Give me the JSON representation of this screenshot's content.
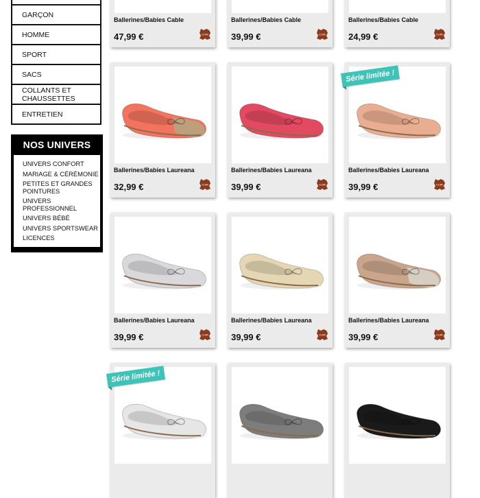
{
  "sidebar": {
    "menu": [
      "GARÇON",
      "HOMME",
      "SPORT",
      "SACS",
      "COLLANTS ET CHAUSSETTES",
      "ENTRETIEN"
    ],
    "univers_title": "NOS UNIVERS",
    "univers_links": [
      "UNIVERS CONFORT",
      "MARIAGE & CÉRÉMONIE",
      "PETITES ET GRANDES POINTURES",
      "UNIVERS PROFESSIONNEL",
      "UNIVERS BÉBÉ",
      "UNIVERS SPORTSWEAR",
      "LICENCES"
    ]
  },
  "leather_icon_label": "CUIR",
  "badge_label": "Série limitée !",
  "products": [
    {
      "title": "Ballerines/Babies Cable",
      "price": "47,99 €",
      "color": "#333333",
      "badge": false
    },
    {
      "title": "Ballerines/Babies Cable",
      "price": "39,99 €",
      "color": "#c9bfb5",
      "badge": false
    },
    {
      "title": "Ballerines/Babies Cable",
      "price": "24,99 €",
      "color": "#ffffff",
      "badge": false
    },
    {
      "title": "Ballerines/Babies Laureana",
      "price": "32,99 €",
      "color": "#f2735e",
      "toe": "#b9a27c",
      "badge": false
    },
    {
      "title": "Ballerines/Babies Laureana",
      "price": "39,99 €",
      "color": "#e24a62",
      "badge": false
    },
    {
      "title": "Ballerines/Babies Laureana",
      "price": "39,99 €",
      "color": "#e9ae92",
      "badge": true
    },
    {
      "title": "Ballerines/Babies Laureana",
      "price": "39,99 €",
      "color": "#d9d9dc",
      "badge": false
    },
    {
      "title": "Ballerines/Babies Laureana",
      "price": "39,99 €",
      "color": "#e5d7b4",
      "badge": false
    },
    {
      "title": "Ballerines/Babies Laureana",
      "price": "39,99 €",
      "color": "#c9a58c",
      "toe": "#d6d0c4",
      "badge": false
    },
    {
      "title": "",
      "price": "",
      "color": "#e6e6e6",
      "badge": true
    },
    {
      "title": "",
      "price": "",
      "color": "#7d7d7d",
      "badge": false
    },
    {
      "title": "",
      "price": "",
      "color": "#1a1a1a",
      "badge": false
    }
  ]
}
